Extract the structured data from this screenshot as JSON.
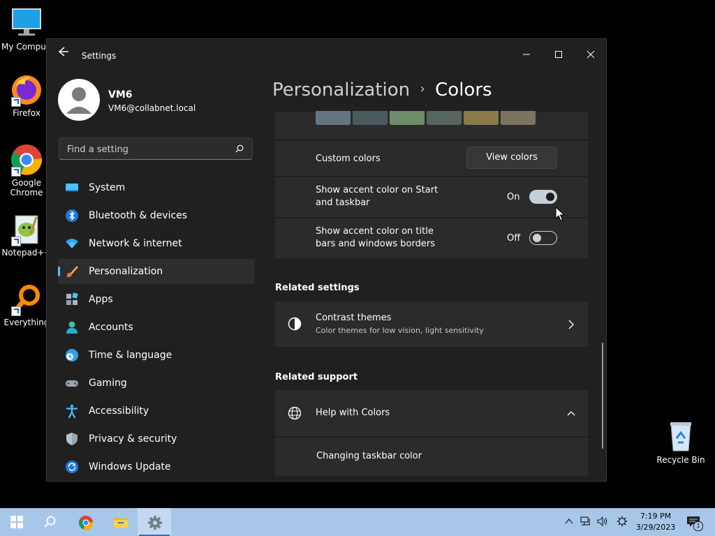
{
  "desktop": {
    "icons": [
      {
        "label": "My Comput"
      },
      {
        "label": "Firefox"
      },
      {
        "label": "Google Chrome"
      },
      {
        "label": "Notepad++"
      },
      {
        "label": "Everything"
      },
      {
        "label": "Recycle Bin"
      }
    ]
  },
  "window": {
    "title": "Settings",
    "controls": [
      "minimize-icon",
      "maximize-icon",
      "close-icon"
    ]
  },
  "profile": {
    "name": "VM6",
    "email": "VM6@collabnet.local"
  },
  "search": {
    "placeholder": "Find a setting"
  },
  "nav": {
    "items": [
      {
        "label": "System",
        "icon": "system-icon"
      },
      {
        "label": "Bluetooth & devices",
        "icon": "bluetooth-icon"
      },
      {
        "label": "Network & internet",
        "icon": "wifi-icon"
      },
      {
        "label": "Personalization",
        "icon": "brush-icon",
        "active": true
      },
      {
        "label": "Apps",
        "icon": "apps-icon"
      },
      {
        "label": "Accounts",
        "icon": "person-icon"
      },
      {
        "label": "Time & language",
        "icon": "clock-globe-icon"
      },
      {
        "label": "Gaming",
        "icon": "gamepad-icon"
      },
      {
        "label": "Accessibility",
        "icon": "accessibility-icon"
      },
      {
        "label": "Privacy & security",
        "icon": "shield-icon"
      },
      {
        "label": "Windows Update",
        "icon": "update-icon"
      }
    ]
  },
  "breadcrumb": {
    "parent": "Personalization",
    "separator": "›",
    "current": "Colors"
  },
  "swatches": [
    "#647580",
    "#4c5a5e",
    "#6e8c6a",
    "#56655e",
    "#8a7a4a",
    "#7a7460"
  ],
  "custom_colors": {
    "label": "Custom colors",
    "button": "View colors"
  },
  "accent_start": {
    "label_line1": "Show accent color on Start",
    "label_line2": "and taskbar",
    "state_text": "On"
  },
  "accent_title": {
    "label_line1": "Show accent color on title",
    "label_line2": "bars and windows borders",
    "state_text": "Off"
  },
  "related_settings": {
    "title": "Related settings",
    "contrast": {
      "title": "Contrast themes",
      "subtitle": "Color themes for low vision, light sensitivity"
    }
  },
  "related_support": {
    "title": "Related support",
    "help": {
      "title": "Help with Colors",
      "link": "Changing taskbar color"
    }
  },
  "taskbar": {
    "time": "7:19 PM",
    "date": "3/29/2023",
    "notification_count": "1"
  },
  "colors": {
    "accent": "#4cc2ff",
    "toggle_on": "#c5cfd9",
    "taskbar": "#a7c7e9"
  }
}
